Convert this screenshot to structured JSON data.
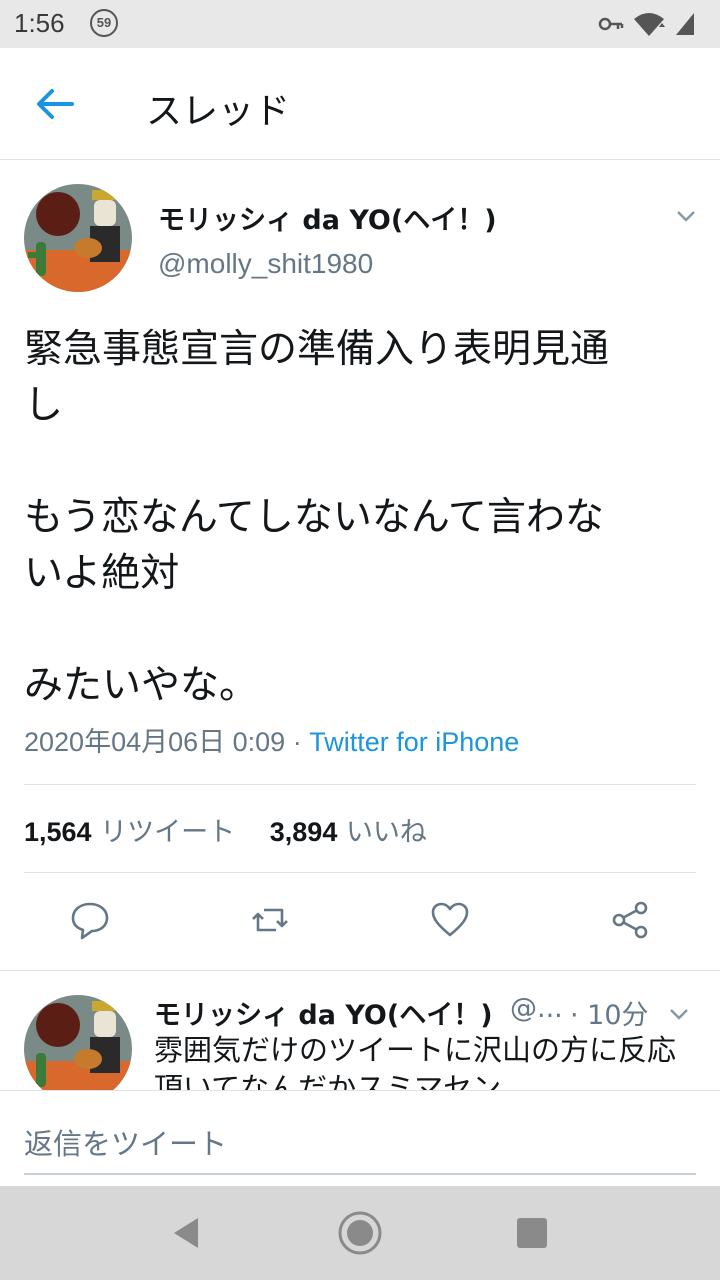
{
  "status": {
    "time": "1:56",
    "badge": "59"
  },
  "header": {
    "title": "スレッド"
  },
  "tweet": {
    "display_name": "モリッシィ da YO(ヘイ！)",
    "handle": "@molly_shit1980",
    "text_lines": [
      "緊急事態宣言の準備入り表明見通",
      "し",
      "もう恋なんてしないなんて言わな",
      "いよ絶対",
      "みたいやな。"
    ],
    "date": "2020年04月06日 0:09",
    "separator": "·",
    "source": "Twitter for iPhone",
    "retweet_count": "1,564",
    "retweet_label": "リツイート",
    "like_count": "3,894",
    "like_label": "いいね"
  },
  "reply": {
    "display_name": "モリッシィ da YO(ヘイ！)",
    "handle": "@...",
    "time": "· 10分",
    "text": "雰囲気だけのツイートに沢山の方に反応頂いてなんだかスミマセン"
  },
  "reply_bar": {
    "placeholder": "返信をツイート"
  },
  "colors": {
    "accent": "#1b95e0",
    "secondary_text": "#657786",
    "primary_text": "#14171a"
  }
}
